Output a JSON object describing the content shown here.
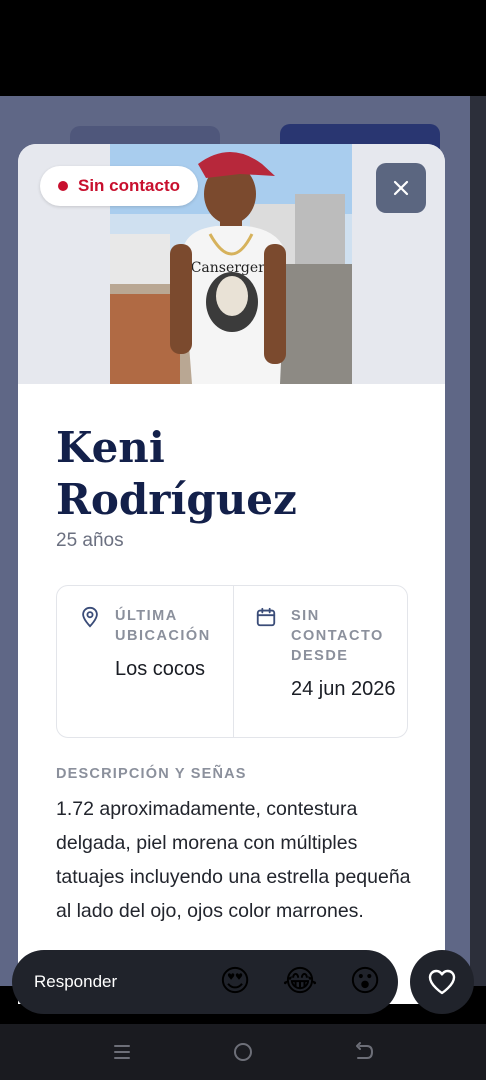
{
  "status_badge": {
    "label": "Sin contacto",
    "color": "#c8102e"
  },
  "close_icon": "close-icon",
  "profile": {
    "name_line1": "Keni",
    "name_line2": "Rodríguez",
    "age": "25 años"
  },
  "info": {
    "location_label": "ÚLTIMA UBICACIÓN",
    "location_value": "Los cocos",
    "since_label": "SIN CONTACTO DESDE",
    "since_value": "24 jun 2026"
  },
  "description": {
    "label": "DESCRIPCIÓN Y SEÑAS",
    "text": "1.72 aproximadamente, contestura delgada, piel morena con múltiples tatuajes incluyendo una estrella pequeña al lado del ojo, ojos color marrones."
  },
  "reply_bar": {
    "placeholder": "Responder",
    "emojis": [
      "😍",
      "😂",
      "😮"
    ]
  },
  "colors": {
    "title": "#13204a",
    "accent": "#c8102e",
    "backdrop": "#5f6786"
  }
}
